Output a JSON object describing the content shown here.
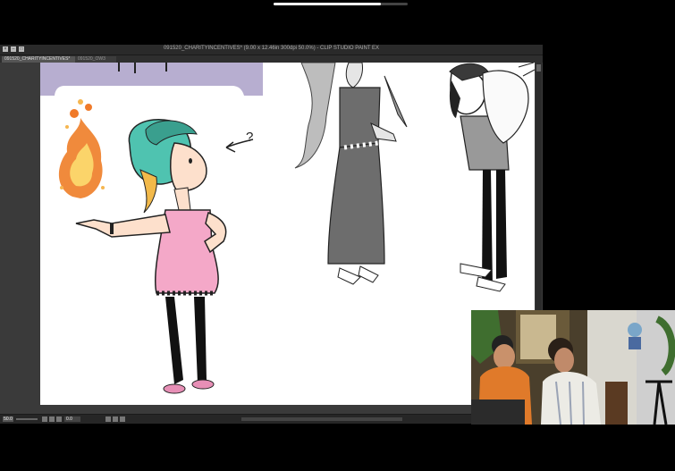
{
  "video_progress": 0.8,
  "window": {
    "title": "091520_CHARITYINCENTIVES* (9.00 x 12.46in 300dpi 50.0%)  - CLIP STUDIO PAINT EX",
    "tabs": [
      {
        "label": "091520_CHARITYINCENTIVES*",
        "active": true
      },
      {
        "label": "091520_OW3",
        "active": false
      }
    ]
  },
  "statusbar": {
    "zoom": "50.0",
    "angle": "0.0"
  },
  "colors": {
    "canvas_bg": "#ffffff",
    "lavender_panel": "#b7aed0",
    "app_bg": "#3a3a3a"
  },
  "illustration": {
    "question_mark": "?"
  }
}
